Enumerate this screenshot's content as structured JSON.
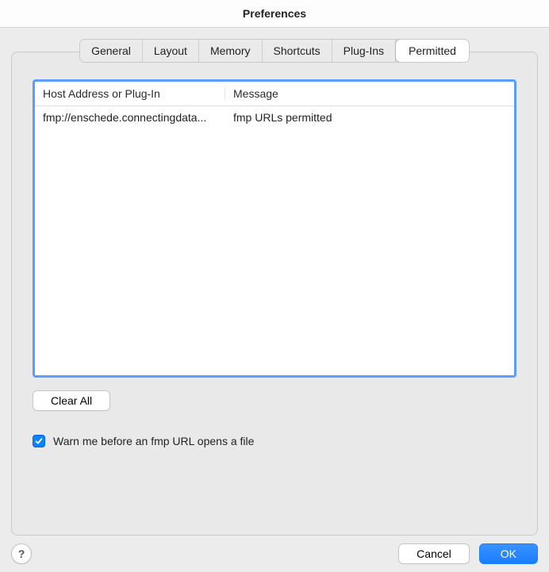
{
  "window": {
    "title": "Preferences"
  },
  "tabs": {
    "items": [
      "General",
      "Layout",
      "Memory",
      "Shortcuts",
      "Plug-Ins",
      "Permitted"
    ],
    "active_index": 5
  },
  "table": {
    "headers": {
      "col0": "Host Address or Plug-In",
      "col1": "Message"
    },
    "rows": [
      {
        "host": "fmp://enschede.connectingdata...",
        "message": "fmp URLs permitted"
      }
    ]
  },
  "buttons": {
    "clear_all": "Clear All",
    "cancel": "Cancel",
    "ok": "OK",
    "help_label": "?"
  },
  "checkbox": {
    "warn_label": "Warn me before an fmp URL opens a file",
    "warn_checked": true
  }
}
